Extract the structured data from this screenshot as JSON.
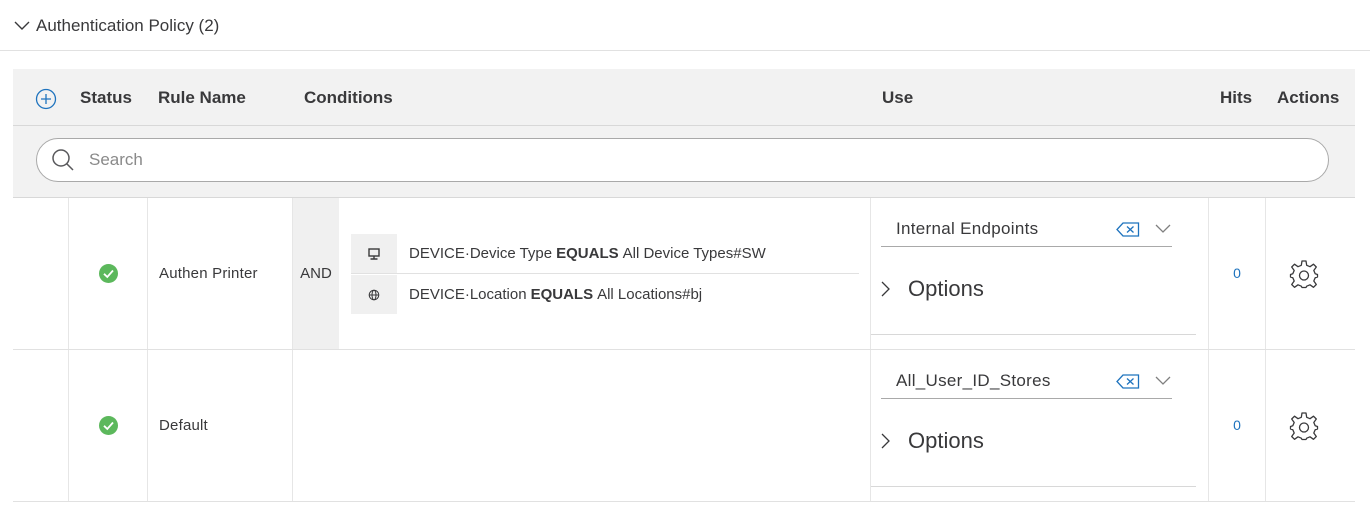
{
  "section": {
    "title": "Authentication Policy (2)"
  },
  "table": {
    "columns": {
      "status": "Status",
      "rule_name": "Rule Name",
      "conditions": "Conditions",
      "use": "Use",
      "hits": "Hits",
      "actions": "Actions"
    },
    "search": {
      "placeholder": "Search",
      "value": ""
    }
  },
  "rows": [
    {
      "status": "enabled",
      "rule_name": "Authen Printer",
      "operator": "AND",
      "conditions": [
        {
          "icon": "device-type-icon",
          "attribute": "DEVICE·Device Type",
          "operator": "EQUALS",
          "value": "All Device Types#SW"
        },
        {
          "icon": "globe-icon",
          "attribute": "DEVICE·Location",
          "operator": "EQUALS",
          "value": "All Locations#bj"
        }
      ],
      "use": "Internal Endpoints",
      "options_label": "Options",
      "hits": "0"
    },
    {
      "status": "enabled",
      "rule_name": "Default",
      "use": "All_User_ID_Stores",
      "options_label": "Options",
      "hits": "0"
    }
  ],
  "colors": {
    "accent": "#1e73be",
    "success": "#5cb85c",
    "text": "#39393b",
    "header_bg": "#f2f2f2"
  }
}
